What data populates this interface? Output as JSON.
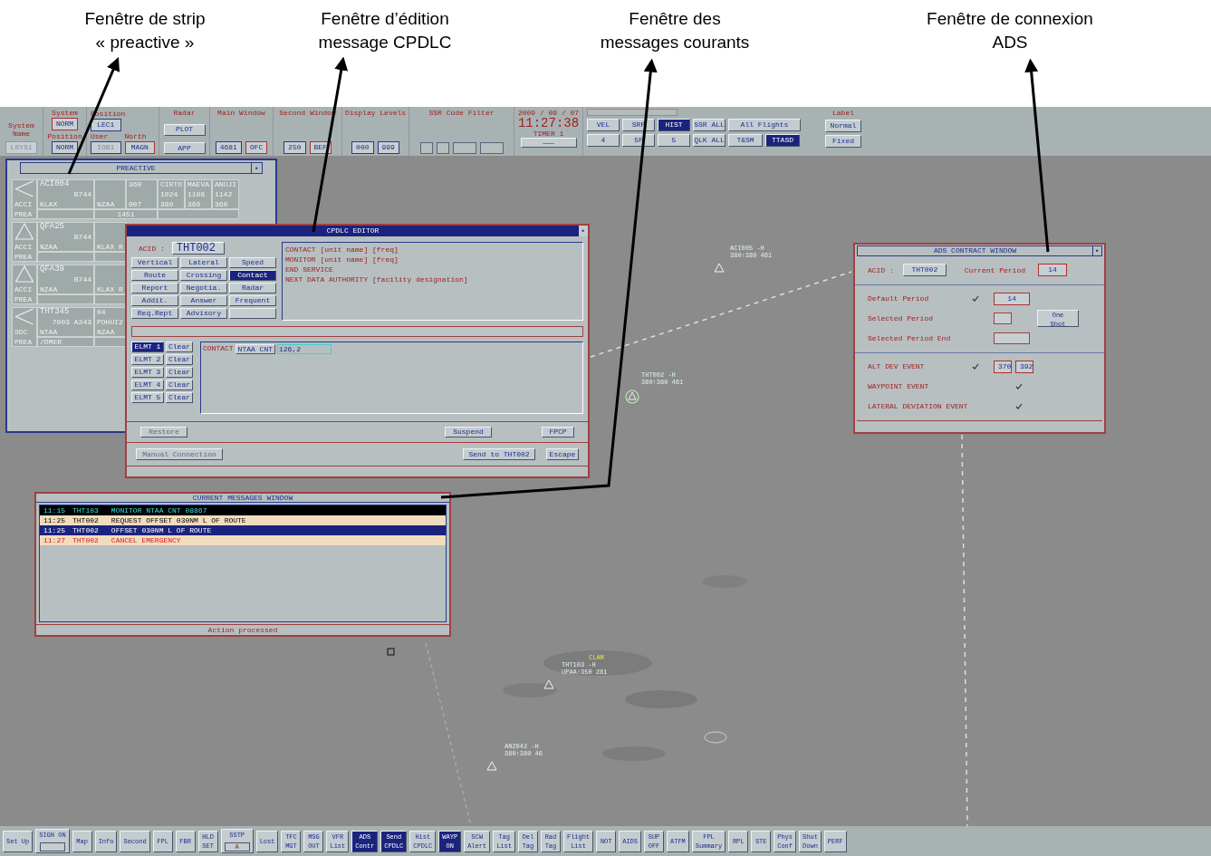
{
  "annotations": [
    {
      "text": "Fenêtre de strip\n« preactive »"
    },
    {
      "text": "Fenêtre d’édition\nmessage CPDLC"
    },
    {
      "text": "Fenêtre des\nmessages courants"
    },
    {
      "text": "Fenêtre de connexion\nADS"
    }
  ],
  "top_bar": {
    "system_name": {
      "label": "System\nName",
      "value": "LSYS1"
    },
    "system": {
      "label": "System",
      "value": "NORM"
    },
    "position_status": {
      "label": "Position",
      "value": "NORM"
    },
    "position": {
      "label": "Position",
      "value": "LEC1"
    },
    "user": {
      "label": "User",
      "value": "IOB1"
    },
    "north": {
      "label": "North",
      "value": "MAGN"
    },
    "radar": {
      "label": "Radar",
      "buttons": [
        "PLOT",
        "APP"
      ]
    },
    "main_window": {
      "label": "Main Window",
      "values": [
        "4681",
        "OFC"
      ]
    },
    "second_window": {
      "label": "Second Window",
      "values": [
        "250",
        "BEF"
      ]
    },
    "display_levels": {
      "label": "Display Levels",
      "values": [
        "000",
        "999"
      ]
    },
    "ssr_code_filter": {
      "label": "SSR Code Filter"
    },
    "clock": {
      "date": "2009 / 09 / 07",
      "time": "11:27:38",
      "timer": "TIMER 1",
      "timer_button": "———"
    },
    "filters": [
      [
        {
          "label": "VEL",
          "selected": false
        },
        {
          "label": "SRP",
          "selected": false
        },
        {
          "label": "HIST",
          "selected": true
        },
        {
          "label": "SSR ALL",
          "selected": false
        },
        {
          "label": "All Flights",
          "selected": false
        }
      ],
      [
        {
          "label": "4",
          "selected": false
        },
        {
          "label": "5F",
          "selected": false
        },
        {
          "label": "5",
          "selected": false
        },
        {
          "label": "QLK ALL",
          "selected": false
        },
        {
          "label": "T&SM",
          "selected": false
        },
        {
          "label": "TTASD",
          "selected": true
        }
      ]
    ],
    "label_group": {
      "label": "Label",
      "buttons": [
        "Normal",
        "Fixed"
      ]
    }
  },
  "preactive": {
    "title": "PREACTIVE",
    "close": "▪",
    "strips": [
      {
        "kind": "left",
        "sector": "ACCI",
        "state": "PREA",
        "lines": [
          "ACI004",
          "B744",
          "KLAX"
        ],
        "columns": [
          [
            "NZAA"
          ],
          [
            "360",
            "007"
          ],
          [
            "CIRTO",
            "1024",
            "380"
          ],
          [
            "MAEVA",
            "1108",
            "360"
          ],
          [
            "ANUJI",
            "1142",
            "360"
          ]
        ],
        "footer_note": "1451"
      },
      {
        "kind": "up",
        "sector": "ACCI",
        "state": "PREA",
        "lines": [
          "QFA25",
          "B744",
          "NZAA"
        ],
        "columns": [
          [
            "KLAX R"
          ]
        ]
      },
      {
        "kind": "up",
        "sector": "ACCI",
        "state": "PREA",
        "lines": [
          "QFA39",
          "B744",
          "NZAA"
        ],
        "columns": [
          [
            "KLAX R"
          ]
        ]
      },
      {
        "kind": "left",
        "sector": "SDC",
        "state": "PREA",
        "lines": [
          "THT345",
          "7003  A343",
          "NTAA"
        ],
        "columns": [
          [
            "04",
            "POHUI2",
            "NZAA"
          ]
        ],
        "footer": "/DMER"
      }
    ]
  },
  "cpdlc_editor": {
    "title": "CPDLC EDITOR",
    "close": "▪",
    "acid_label": "ACID :",
    "acid": "THT002",
    "categories": [
      {
        "label": "Vertical",
        "selected": false
      },
      {
        "label": "Lateral",
        "selected": false
      },
      {
        "label": "Speed",
        "selected": false
      },
      {
        "label": "Route",
        "selected": false
      },
      {
        "label": "Crossing",
        "selected": false
      },
      {
        "label": "Contact",
        "selected": true
      },
      {
        "label": "Report",
        "selected": false
      },
      {
        "label": "Negotia.",
        "selected": false
      },
      {
        "label": "Radar",
        "selected": false
      },
      {
        "label": "Addit.",
        "selected": false
      },
      {
        "label": "Answer",
        "selected": false
      },
      {
        "label": "Frequent",
        "selected": false
      },
      {
        "label": "Req.Rept",
        "selected": false
      },
      {
        "label": "Advisory",
        "selected": false
      }
    ],
    "templates": [
      "CONTACT [unit name] [freq]",
      "MONITOR [unit name] [freq]",
      "END SERVICE",
      "NEXT DATA AUTHORITY [facility designation]"
    ],
    "elements": [
      {
        "label": "ELMT 1",
        "selected": true,
        "clear": "Clear"
      },
      {
        "label": "ELMT 2",
        "selected": false,
        "clear": "Clear"
      },
      {
        "label": "ELMT 3",
        "selected": false,
        "clear": "Clear"
      },
      {
        "label": "ELMT 4",
        "selected": false,
        "clear": "Clear"
      },
      {
        "label": "ELMT 5",
        "selected": false,
        "clear": "Clear"
      }
    ],
    "compose": {
      "keyword": "CONTACT",
      "unit": "NTAA CNT",
      "freq": "126,2"
    },
    "actions": [
      [
        {
          "label": "Restore",
          "disabled": true
        },
        {
          "label": "Suspend",
          "disabled": false
        },
        {
          "label": "FPCP",
          "disabled": false
        }
      ],
      [
        {
          "label": "Manual Connection",
          "disabled": true
        },
        {
          "label": "Send to THT002",
          "disabled": false
        },
        {
          "label": "Escape",
          "disabled": false
        }
      ]
    ]
  },
  "current_messages": {
    "title": "CURRENT MESSAGES WINDOW",
    "rows": [
      {
        "kind": "pending",
        "time": "11:15",
        "callsign": "THT103",
        "text": "MONITOR NTAA CNT 08867"
      },
      {
        "kind": "downlink",
        "time": "11:25",
        "callsign": "THT002",
        "text": "REQUEST OFFSET 030NM L OF ROUTE"
      },
      {
        "kind": "uplink",
        "time": "11:25",
        "callsign": "THT002",
        "text": "OFFSET 030NM L OF ROUTE"
      },
      {
        "kind": "emergency",
        "time": "11:27",
        "callsign": "THT002",
        "text": "CANCEL EMERGENCY"
      }
    ],
    "status": "Action processed"
  },
  "ads_contract": {
    "title": "ADS CONTRACT WINDOW",
    "close": "▪",
    "acid_label": "ACID :",
    "acid": "THT002",
    "current_period_label": "Current Period",
    "current_period": "14",
    "periods": [
      {
        "kind": "value",
        "label": "Default Period",
        "checked": true,
        "values": [
          "14"
        ]
      },
      {
        "kind": "input",
        "label": "Selected Period",
        "button": "One\nShot"
      },
      {
        "kind": "input",
        "label": "Selected Period End"
      }
    ],
    "events": [
      {
        "kind": "value",
        "label": "ALT DEV EVENT",
        "checked": true,
        "values": [
          "370",
          "392"
        ]
      },
      {
        "kind": "event",
        "label": "WAYPOINT EVENT",
        "checked": true
      },
      {
        "kind": "event",
        "label": "LATERAL DEVIATION EVENT",
        "checked": true
      }
    ]
  },
  "aircraft": [
    {
      "kind": "triangle",
      "callsign": "ACI005",
      "flag": "-H",
      "data": "380↑380 461"
    },
    {
      "kind": "circled",
      "callsign": "THT002",
      "flag": "-H",
      "data": "380↑380 461"
    },
    {
      "kind": "triangle",
      "callsign": "THT103",
      "flag": "-H",
      "data": "UPAA↑350 281",
      "alert": "CLAM"
    },
    {
      "kind": "triangle",
      "callsign": "ANZ042",
      "flag": "-H",
      "data": "380↑380 46"
    },
    {
      "kind": "square"
    }
  ],
  "bottom_bar": [
    {
      "kind": "button",
      "label": "Set Up",
      "selected": false
    },
    {
      "kind": "field",
      "label": "SIGN ON",
      "selected": false
    },
    {
      "kind": "button",
      "label": "Map",
      "selected": false
    },
    {
      "kind": "button",
      "label": "Info",
      "selected": false
    },
    {
      "kind": "button",
      "label": "Second",
      "selected": false
    },
    {
      "kind": "button",
      "label": "FPL",
      "selected": false
    },
    {
      "kind": "button",
      "label": "FBR",
      "selected": false
    },
    {
      "kind": "button",
      "label": "HLD\nSET",
      "selected": false
    },
    {
      "kind": "field",
      "label": "SSTP",
      "value": "A",
      "selected": false
    },
    {
      "kind": "button",
      "label": "Lost",
      "selected": false
    },
    {
      "kind": "button",
      "label": "TFC\nMGT",
      "selected": false
    },
    {
      "kind": "button",
      "label": "MSG\nOUT",
      "selected": false
    },
    {
      "kind": "button",
      "label": "VFR\nList",
      "selected": false
    },
    {
      "kind": "button",
      "label": "ADS\nContr",
      "selected": true
    },
    {
      "kind": "button",
      "label": "Send\nCPDLC",
      "selected": true
    },
    {
      "kind": "button",
      "label": "Hist\nCPDLC",
      "selected": false
    },
    {
      "kind": "button",
      "label": "WAYP\nON",
      "selected": true
    },
    {
      "kind": "button",
      "label": "SCW\nAlert",
      "selected": false
    },
    {
      "kind": "button",
      "label": "Tag\nList",
      "selected": false
    },
    {
      "kind": "button",
      "label": "Del\nTag",
      "selected": false
    },
    {
      "kind": "button",
      "label": "Rad\nTag",
      "selected": false
    },
    {
      "kind": "button",
      "label": "Flight\nList",
      "selected": false
    },
    {
      "kind": "button",
      "label": "NOT",
      "selected": false
    },
    {
      "kind": "button",
      "label": "AIDS",
      "selected": false
    },
    {
      "kind": "button",
      "label": "SUP\nOFF",
      "selected": false
    },
    {
      "kind": "button",
      "label": "ATFM",
      "selected": false
    },
    {
      "kind": "button",
      "label": "FPL\nSummary",
      "selected": false
    },
    {
      "kind": "button",
      "label": "RPL",
      "selected": false
    },
    {
      "kind": "button",
      "label": "STE",
      "selected": false
    },
    {
      "kind": "button",
      "label": "Phys\nConf",
      "selected": false
    },
    {
      "kind": "button",
      "label": "Shut\nDown",
      "selected": false
    },
    {
      "kind": "button",
      "label": "PERF",
      "selected": false
    }
  ]
}
